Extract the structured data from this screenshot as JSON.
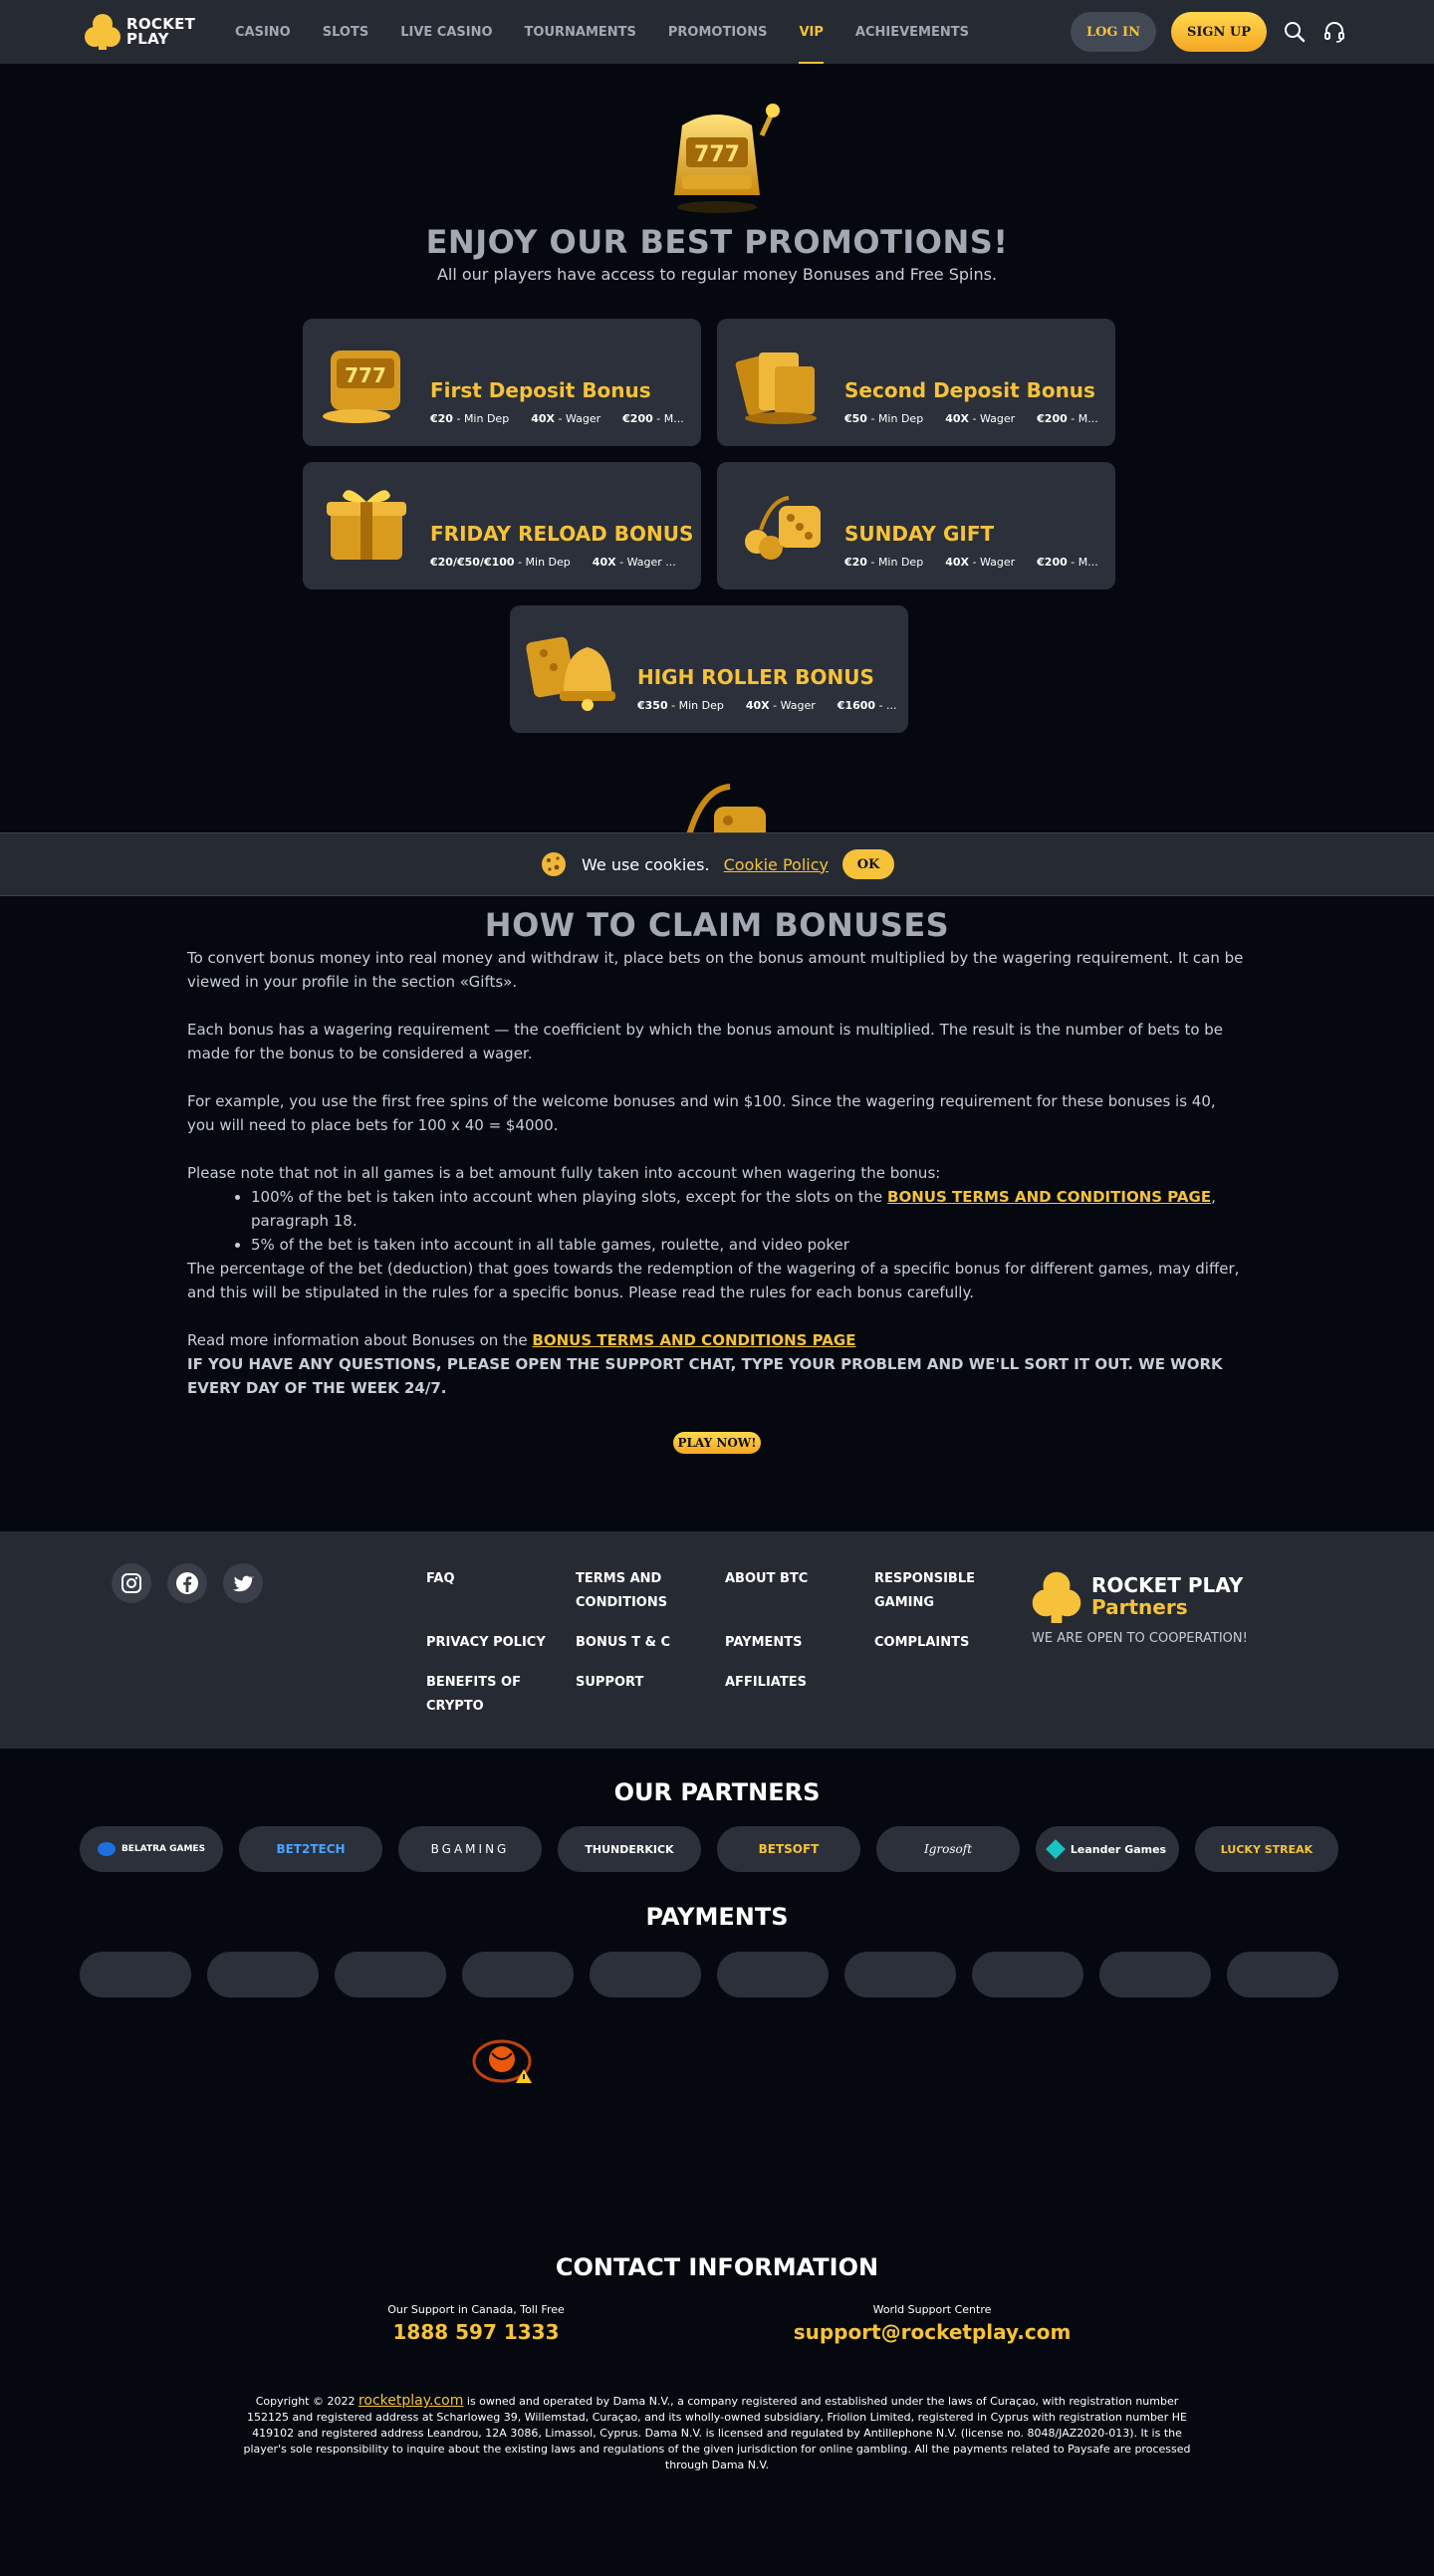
{
  "header": {
    "logo_text_line1": "ROCKET",
    "logo_text_line2": "PLAY",
    "nav": [
      "CASINO",
      "SLOTS",
      "LIVE CASINO",
      "TOURNAMENTS",
      "PROMOTIONS",
      "VIP",
      "ACHIEVEMENTS"
    ],
    "active_nav": "VIP",
    "login_label": "LOG IN",
    "signup_label": "SIGN UP"
  },
  "promotions": {
    "title": "ENJOY OUR BEST PROMOTIONS!",
    "subtitle": "All our players have access to regular money Bonuses and Free Spins.",
    "cards": [
      {
        "title": "First Deposit Bonus",
        "min_dep": "€20",
        "wager": "40X",
        "max": "€200",
        "min_dep_label": "Min Dep",
        "wager_label": "Wager",
        "max_suffix": "M..."
      },
      {
        "title": "Second Deposit Bonus",
        "min_dep": "€50",
        "wager": "40X",
        "max": "€200",
        "min_dep_label": "Min Dep",
        "wager_label": "Wager",
        "max_suffix": "M..."
      },
      {
        "title": "FRIDAY RELOAD BONUS",
        "min_dep": "€20/€50/€100",
        "wager": "40X",
        "max": "",
        "min_dep_label": "Min Dep",
        "wager_label": "Wager ...",
        "max_suffix": ""
      },
      {
        "title": "SUNDAY GIFT",
        "min_dep": "€20",
        "wager": "40X",
        "max": "€200",
        "min_dep_label": "Min Dep",
        "wager_label": "Wager",
        "max_suffix": "M..."
      },
      {
        "title": "HIGH ROLLER BONUS",
        "min_dep": "€350",
        "wager": "40X",
        "max": "€1600",
        "min_dep_label": "Min Dep",
        "wager_label": "Wager",
        "max_suffix": "..."
      }
    ]
  },
  "cookie": {
    "text": "We use cookies.",
    "link": "Cookie Policy",
    "ok": "OK"
  },
  "claim": {
    "title": "HOW TO CLAIM BONUSES",
    "p1": "To convert bonus money into real money and withdraw it, place bets on the bonus amount multiplied by the wagering requirement. It can be viewed in your profile in the section «Gifts».",
    "p2": "Each bonus has a wagering requirement — the coefficient by which the bonus amount is multiplied. The result is the number of bets to be made for the bonus to be considered a wager.",
    "p3": "For example, you use the first free spins of the welcome bonuses and win $100. Since the wagering requirement for these bonuses is 40, you will need to place bets for 100 x 40 = $4000.",
    "p4": "Please note that not in all games is a bet amount fully taken into account when wagering the bonus:",
    "li1_a": "100% of the bet is taken into account when playing slots, except for the slots on the ",
    "li1_link": "BONUS TERMS AND CONDITIONS PAGE",
    "li1_b": ", paragraph 18.",
    "li2": "5% of the bet is taken into account in all table games, roulette, and video poker",
    "p5": "The percentage of the bet (deduction) that goes towards the redemption of the wagering of a specific bonus for different games, may differ, and this will be stipulated in the rules for a specific bonus. Please read the rules for each bonus carefully.",
    "p6_a": "Read more information about Bonuses on the ",
    "p6_link": "BONUS TERMS AND CONDITIONS PAGE",
    "p7": "IF YOU HAVE ANY QUESTIONS, PLEASE OPEN THE SUPPORT CHAT, TYPE YOUR PROBLEM AND WE'LL SORT IT OUT. WE WORK EVERY DAY OF THE WEEK 24/7.",
    "play_now": "PLAY NOW!"
  },
  "footer": {
    "links": [
      "FAQ",
      "TERMS AND CONDITIONS",
      "ABOUT BTC",
      "RESPONSIBLE GAMING",
      "PRIVACY POLICY",
      "BONUS T & C",
      "PAYMENTS",
      "COMPLAINTS",
      "BENEFITS OF CRYPTO",
      "SUPPORT",
      "AFFILIATES"
    ],
    "partner_line1": "ROCKET PLAY",
    "partner_line2": "Partners",
    "coop": "WE ARE OPEN TO COOPERATION!"
  },
  "partners": {
    "title": "OUR PARTNERS",
    "items": [
      "BELATRA GAMES",
      "BET2TECH",
      "BGAMING",
      "THUNDERKICK",
      "BETSOFT",
      "Igrosoft",
      "Leander Games",
      "LUCKY STREAK"
    ]
  },
  "payments": {
    "title": "PAYMENTS"
  },
  "contact": {
    "title": "CONTACT INFORMATION",
    "phone_label": "Our Support in Canada, Toll Free",
    "phone": "1888 597 1333",
    "email_label": "World Support Centre",
    "email": "support@rocketplay.com"
  },
  "copyright": {
    "prefix": "Copyright © 2022 ",
    "site": "rocketplay.com",
    "body": " is owned and operated by Dama N.V., a company registered and established under the laws of Curaçao, with registration number 152125 and registered address at Scharloweg 39, Willemstad, Curaçao, and its wholly-owned subsidiary, Friolion Limited, registered in Cyprus with registration number HE 419102 and registered address Leandrou, 12A 3086, Limassol, Cyprus. Dama N.V. is licensed and regulated by Antillephone N.V. (license no. 8048/JAZ2020-013). It is the player's sole responsibility to inquire about the existing laws and regulations of the given jurisdiction for online gambling. All the payments related to Paysafe are processed through Dama N.V."
  },
  "colors": {
    "accent": "#f6c23a",
    "panel": "#262a33",
    "card": "#2b303a",
    "background": "#05090f"
  }
}
